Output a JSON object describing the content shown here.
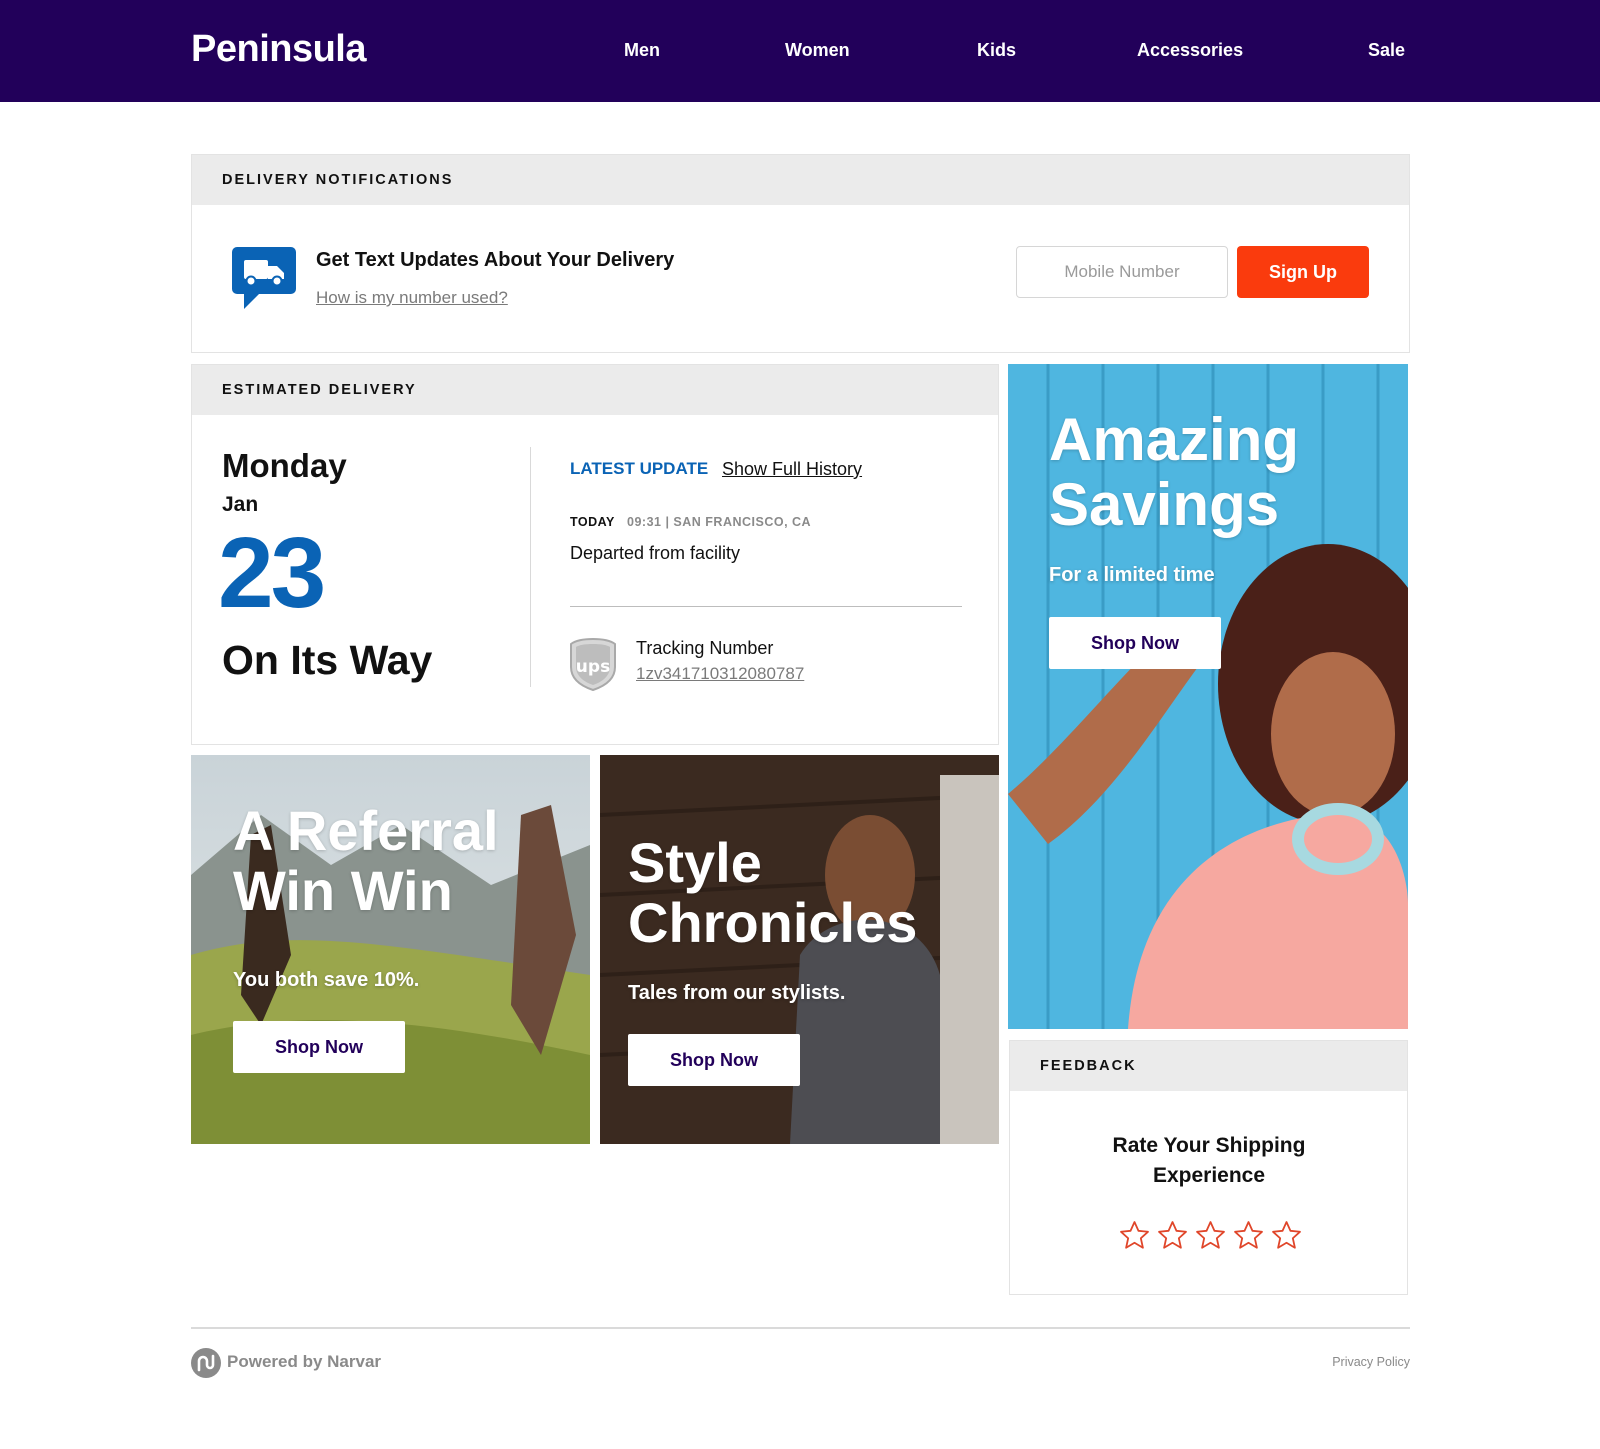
{
  "header": {
    "brand": "Peninsula",
    "nav": [
      "Men",
      "Women",
      "Kids",
      "Accessories",
      "Sale"
    ],
    "background_color": "#22005a"
  },
  "notifications": {
    "heading": "DELIVERY NOTIFICATIONS",
    "title": "Get Text Updates About Your Delivery",
    "link": "How is my number used?",
    "mobile_placeholder": "Mobile Number",
    "mobile_value": "",
    "signup_label": "Sign Up",
    "signup_color": "#fa3b0d",
    "icon": "truck-chat-icon"
  },
  "delivery": {
    "heading": "ESTIMATED DELIVERY",
    "day": "Monday",
    "month": "Jan",
    "date": "23",
    "status": "On Its Way",
    "latest_label": "LATEST UPDATE",
    "history_link": "Show Full History",
    "update_day": "TODAY",
    "update_meta": "09:31 | SAN FRANCISCO, CA",
    "update_event": "Departed from facility",
    "carrier_logo": "ups-icon",
    "tracking_label": "Tracking Number",
    "tracking_number": "1zv341710312080787",
    "accent_color": "#0a63b5"
  },
  "promos": {
    "savings": {
      "title": [
        "Amazing",
        "Savings"
      ],
      "subtitle": "For a limited time",
      "button": "Shop Now"
    },
    "referral": {
      "title": [
        "A Referral",
        "Win Win"
      ],
      "subtitle": "You both save 10%.",
      "button": "Shop Now"
    },
    "style": {
      "title": [
        "Style",
        "Chronicles"
      ],
      "subtitle": "Tales from our stylists.",
      "button": "Shop Now"
    }
  },
  "feedback": {
    "heading": "FEEDBACK",
    "prompt_line1": "Rate Your Shipping",
    "prompt_line2": "Experience",
    "rating": 0,
    "max_rating": 5,
    "star_color": "#e0462a"
  },
  "footer": {
    "powered_by": "Powered by Narvar",
    "privacy": "Privacy Policy"
  }
}
